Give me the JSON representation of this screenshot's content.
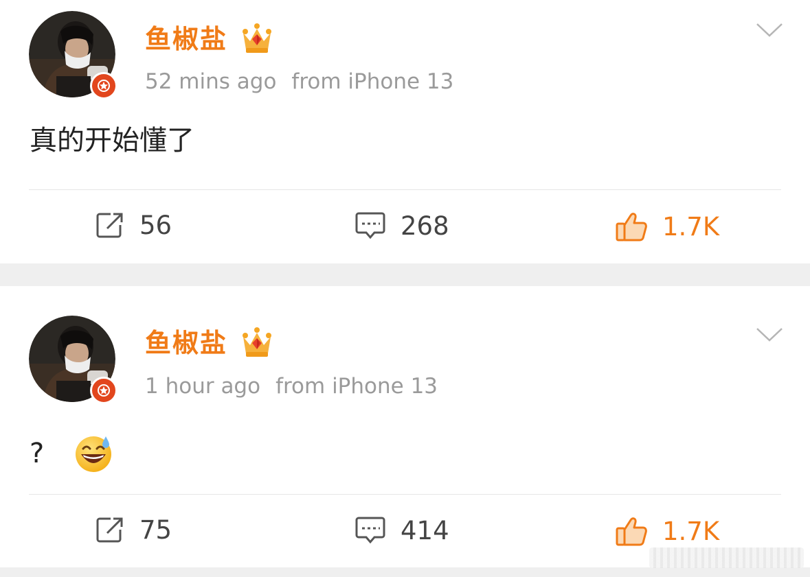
{
  "posts": [
    {
      "username": "鱼椒盐",
      "time": "52 mins ago",
      "source": "from iPhone 13",
      "content": "真的开始懂了",
      "reposts": "56",
      "comments": "268",
      "likes": "1.7K"
    },
    {
      "username": "鱼椒盐",
      "time": "1 hour ago",
      "source": "from iPhone 13",
      "content": "?",
      "content_emoji": "grinning-sweat-emoji",
      "reposts": "75",
      "comments": "414",
      "likes": "1.7K"
    }
  ],
  "colors": {
    "accent": "#f07b17",
    "meta_text": "#9a9a9a",
    "body_text": "#222222",
    "verify_badge": "#e2461d",
    "separator": "#efefef"
  },
  "icons": {
    "verified": "verified-star-icon",
    "crown": "vip-crown-icon",
    "menu": "chevron-down-icon",
    "repost": "repost-icon",
    "comment": "comment-icon",
    "like": "thumbs-up-icon"
  }
}
